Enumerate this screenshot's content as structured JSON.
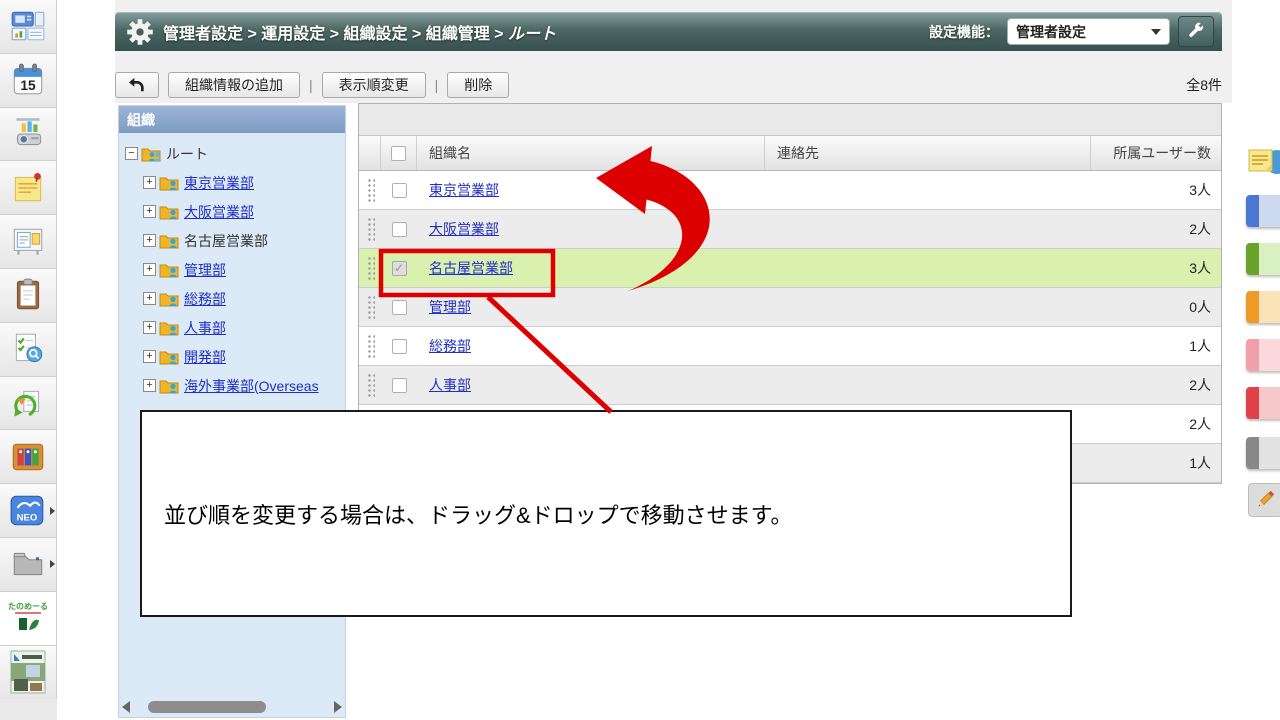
{
  "header": {
    "breadcrumb_prefix": "管理者設定 > 運用設定 > 組織設定 > 組織管理 > ",
    "breadcrumb_current": "ルート",
    "setting_label": "設定機能：",
    "setting_value": "管理者設定"
  },
  "toolbar": {
    "add": "組織情報の追加",
    "sep": "|",
    "order": "表示順変更",
    "delete": "削除",
    "total": "全8件"
  },
  "tree": {
    "title": "組織",
    "root_label": "ルート",
    "items": [
      {
        "label": "東京営業部"
      },
      {
        "label": "大阪営業部"
      },
      {
        "label": "名古屋営業部",
        "plain": true
      },
      {
        "label": "管理部"
      },
      {
        "label": "総務部"
      },
      {
        "label": "人事部"
      },
      {
        "label": "開発部"
      },
      {
        "label": "海外事業部(Overseas"
      }
    ]
  },
  "table": {
    "headers": {
      "name": "組織名",
      "contact": "連絡先",
      "users": "所属ユーザー数"
    },
    "rows": [
      {
        "name": "東京営業部",
        "contact": "",
        "users": "3人"
      },
      {
        "name": "大阪営業部",
        "contact": "",
        "users": "2人"
      },
      {
        "name": "名古屋営業部",
        "contact": "",
        "users": "3人",
        "checked": true,
        "highlight": true
      },
      {
        "name": "管理部",
        "contact": "",
        "users": "0人"
      },
      {
        "name": "総務部",
        "contact": "",
        "users": "1人"
      },
      {
        "name": "人事部",
        "contact": "",
        "users": "2人"
      },
      {
        "name": "",
        "contact": "",
        "users": "2人"
      },
      {
        "name": "",
        "contact": "",
        "users": "1人"
      }
    ]
  },
  "callout": {
    "text": "並び順を変更する場合は、ドラッグ&ドロップで移動させます。"
  },
  "left_dock": {
    "calendar_day": "15",
    "neo_label": "NEO",
    "tanomail_label": "たのめーる",
    "icons": [
      "portal-icon",
      "calendar-icon",
      "presentation-icon",
      "sticky-note-icon",
      "bulletin-board-icon",
      "clipboard-icon",
      "survey-icon",
      "circulation-icon",
      "binders-icon",
      "neo-icon",
      "cabinet-icon",
      "tanomail-icon",
      "banner-icon"
    ]
  },
  "right_dock": {
    "icons": [
      "memo-user-icon",
      "blue-book-icon",
      "green-book-icon",
      "orange-book-icon",
      "pink-book-icon",
      "red-book-icon",
      "grey-book-icon",
      "pencil-icon"
    ]
  },
  "colors": {
    "header_teal": "#4c6764",
    "accent_red": "#dd0000",
    "highlight_green": "#d9f0ae",
    "link_blue": "#1f2fc4",
    "tree_header_blue": "#8fa9cf"
  }
}
